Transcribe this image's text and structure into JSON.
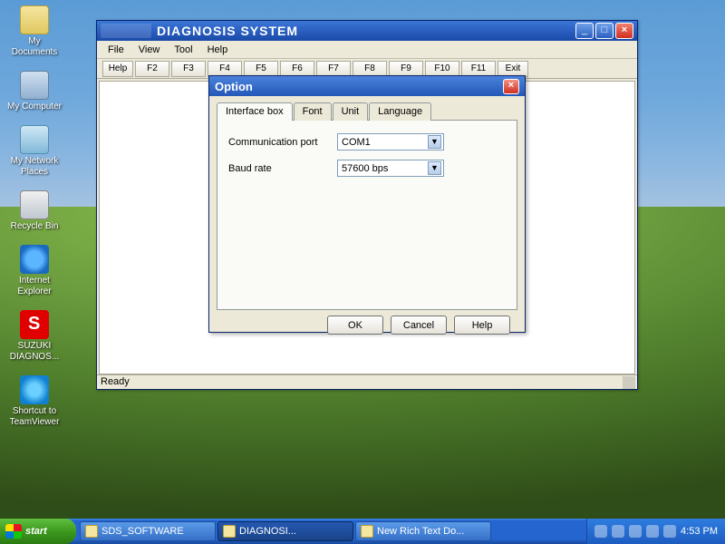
{
  "desktop_icons": [
    {
      "label": "My Documents"
    },
    {
      "label": "My Computer"
    },
    {
      "label": "My Network Places"
    },
    {
      "label": "Recycle Bin"
    },
    {
      "label": "Internet Explorer"
    },
    {
      "label": "SUZUKI DIAGNOS..."
    },
    {
      "label": "Shortcut to TeamViewer"
    }
  ],
  "app": {
    "title": "DIAGNOSIS SYSTEM",
    "menu": {
      "file": "File",
      "view": "View",
      "tool": "Tool",
      "help": "Help"
    },
    "fn": {
      "help": "Help",
      "f2": "F2",
      "f3": "F3",
      "f4": "F4",
      "f5": "F5",
      "f6": "F6",
      "f7": "F7",
      "f8": "F8",
      "f9": "F9",
      "f10": "F10",
      "f11": "F11",
      "exit": "Exit"
    },
    "status": "Ready"
  },
  "dialog": {
    "title": "Option",
    "tabs": {
      "interface": "Interface box",
      "font": "Font",
      "unit": "Unit",
      "language": "Language"
    },
    "comm_label": "Communication port",
    "comm_value": "COM1",
    "baud_label": "Baud rate",
    "baud_value": "57600 bps",
    "ok": "OK",
    "cancel": "Cancel",
    "help": "Help"
  },
  "taskbar": {
    "start": "start",
    "items": [
      {
        "label": "SDS_SOFTWARE"
      },
      {
        "label": "DIAGNOSI..."
      },
      {
        "label": "New Rich Text Do..."
      }
    ],
    "time": "4:53 PM"
  }
}
